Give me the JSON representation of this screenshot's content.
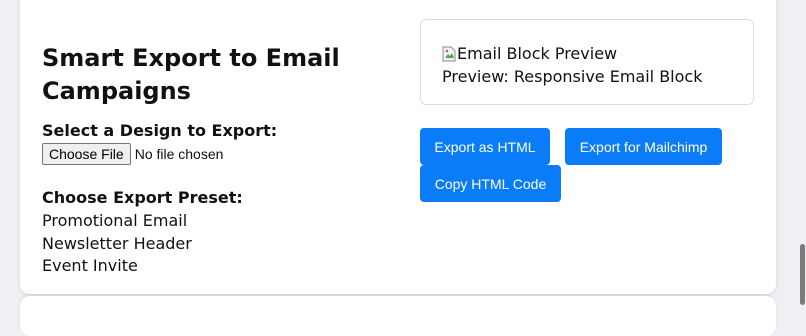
{
  "section": {
    "title": "Smart Export to Email Campaigns",
    "select_label": "Select a Design to Export:",
    "file_button": "Choose File",
    "file_status": "No file chosen",
    "preset_label": "Choose Export Preset:",
    "presets": [
      "Promotional Email",
      "Newsletter Header",
      "Event Invite"
    ]
  },
  "preview": {
    "image_alt": "Email Block Preview",
    "caption": "Preview: Responsive Email Block"
  },
  "actions": {
    "export_html": "Export as HTML",
    "export_mailchimp": "Export for Mailchimp",
    "copy_html": "Copy HTML Code"
  },
  "colors": {
    "accent": "#0a7cf8",
    "card_bg": "#ffffff",
    "page_bg": "#eef0f3"
  },
  "icons": {
    "broken_image": "broken-image-icon"
  }
}
